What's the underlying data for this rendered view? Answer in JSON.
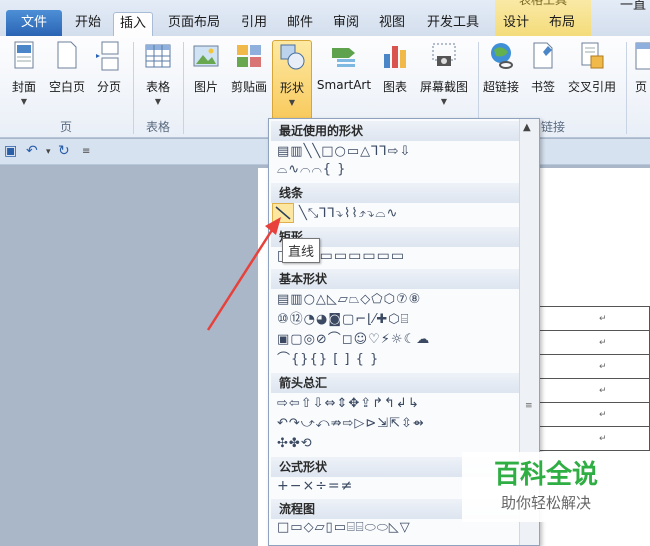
{
  "tabs": {
    "file": "文件",
    "home": "开始",
    "insert": "插入",
    "layout": "页面布局",
    "references": "引用",
    "mailings": "邮件",
    "review": "审阅",
    "view": "视图",
    "developer": "开发工具",
    "design": "设计",
    "table_layout": "布局",
    "context_group": "表格工具",
    "top_right": "一直"
  },
  "ribbon": {
    "cover": "封面",
    "blank_page": "空白页",
    "page_break": "分页",
    "table": "表格",
    "picture": "图片",
    "clipart": "剪贴画",
    "shapes": "形状",
    "smartart": "SmartArt",
    "chart": "图表",
    "screenshot": "屏幕截图",
    "hyperlink": "超链接",
    "bookmark": "书签",
    "crossref": "交叉引用",
    "header_partial": "页",
    "group_pages": "页",
    "group_tables": "表格",
    "group_links": "链接"
  },
  "dropdown": {
    "recent": "最近使用的形状",
    "lines": "线条",
    "rectangles": "矩形",
    "basic": "基本形状",
    "arrows": "箭头总汇",
    "equation": "公式形状",
    "flowchart": "流程图"
  },
  "tooltip": "直线",
  "doc_table": {
    "cell_mark": "↵"
  },
  "watermark": {
    "main": "百科全说",
    "sub": "助你轻松解决"
  },
  "colors": {
    "file_tab": "#2a64b4",
    "context_tab": "#f4dc7a",
    "pressed_button": "#f8c95b",
    "annotation_arrow": "#e8403a",
    "watermark_green": "#2fae43"
  }
}
